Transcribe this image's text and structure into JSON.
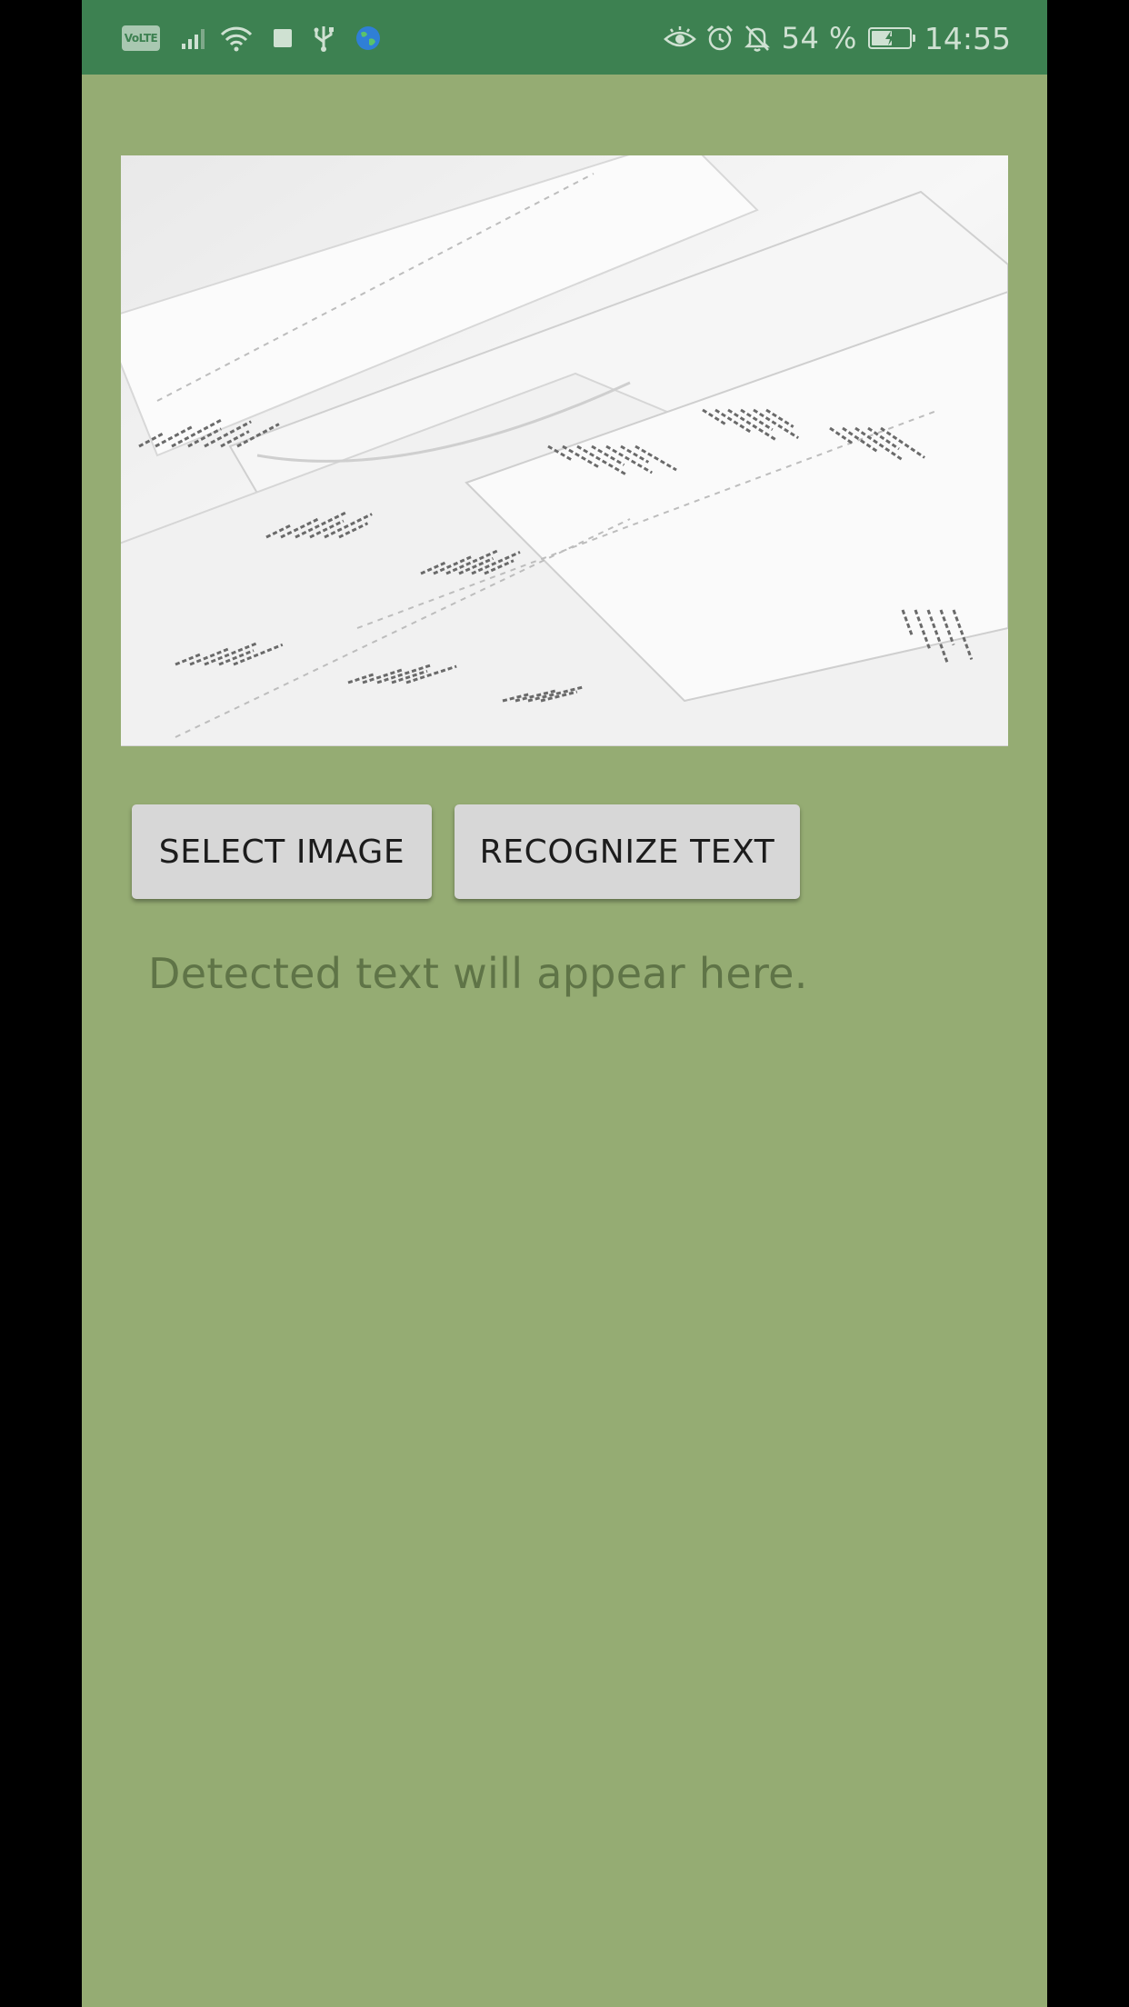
{
  "status_bar": {
    "network_badge": "VoLTE",
    "icons_left": [
      "signal-icon",
      "wifi-icon",
      "notification-square-icon",
      "usb-icon",
      "globe-icon"
    ],
    "icons_right": [
      "eye-icon",
      "alarm-icon",
      "bell-off-icon"
    ],
    "battery_percent": "54 %",
    "battery_level": 0.54,
    "time": "14:55"
  },
  "image_view": {
    "icon": "receipts-photo"
  },
  "buttons": {
    "select_image": "SELECT IMAGE",
    "recognize_text": "RECOGNIZE TEXT"
  },
  "result": {
    "text": "Detected text will appear here."
  },
  "colors": {
    "status_bar": "#3d8151",
    "background": "#95ac73",
    "button": "#d7d7d7",
    "hint_text": "#5f7447"
  }
}
